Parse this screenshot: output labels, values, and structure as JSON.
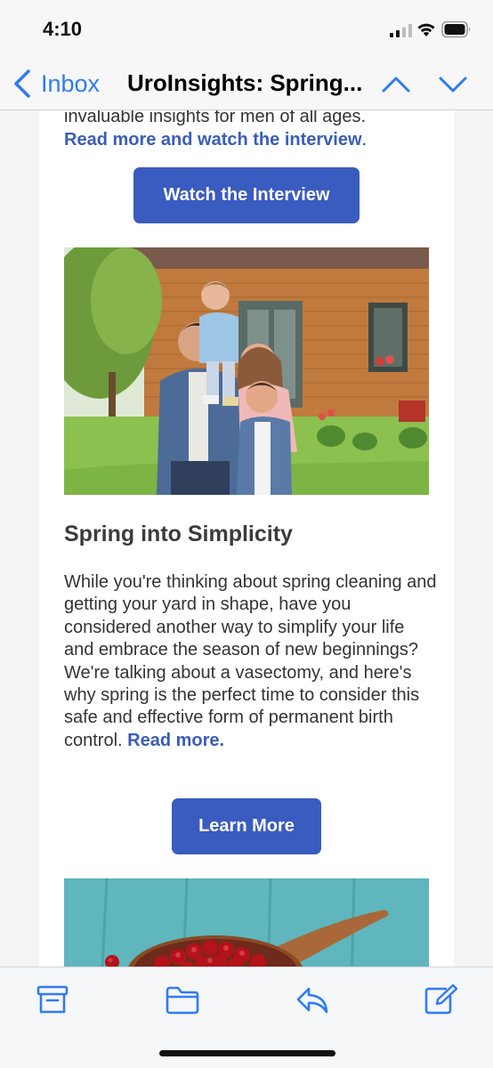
{
  "status_bar": {
    "time": "4:10"
  },
  "nav": {
    "back_label": "Inbox",
    "title": "UroInsights: Spring..."
  },
  "email": {
    "intro_partial": "invaluable insights for men of all ages.",
    "intro_link": "Read more and watch the interview",
    "intro_link_suffix": ".",
    "watch_button": "Watch the Interview",
    "section_title": "Spring into Simplicity",
    "section_body": "While you're thinking about spring cleaning and getting your yard in shape, have you considered another way to simplify your life and embrace the season of new beginnings? We're talking about a vasectomy, and here's why spring is the perfect time to consider this safe and effective form of permanent birth control.",
    "section_link": "Read more.",
    "learn_button": "Learn More"
  },
  "colors": {
    "accent": "#2f7bf5",
    "button": "#3a5bbf",
    "link": "#3a5db8"
  },
  "toolbar": {
    "icons": [
      "archive-icon",
      "folder-icon",
      "reply-icon",
      "compose-icon"
    ]
  }
}
